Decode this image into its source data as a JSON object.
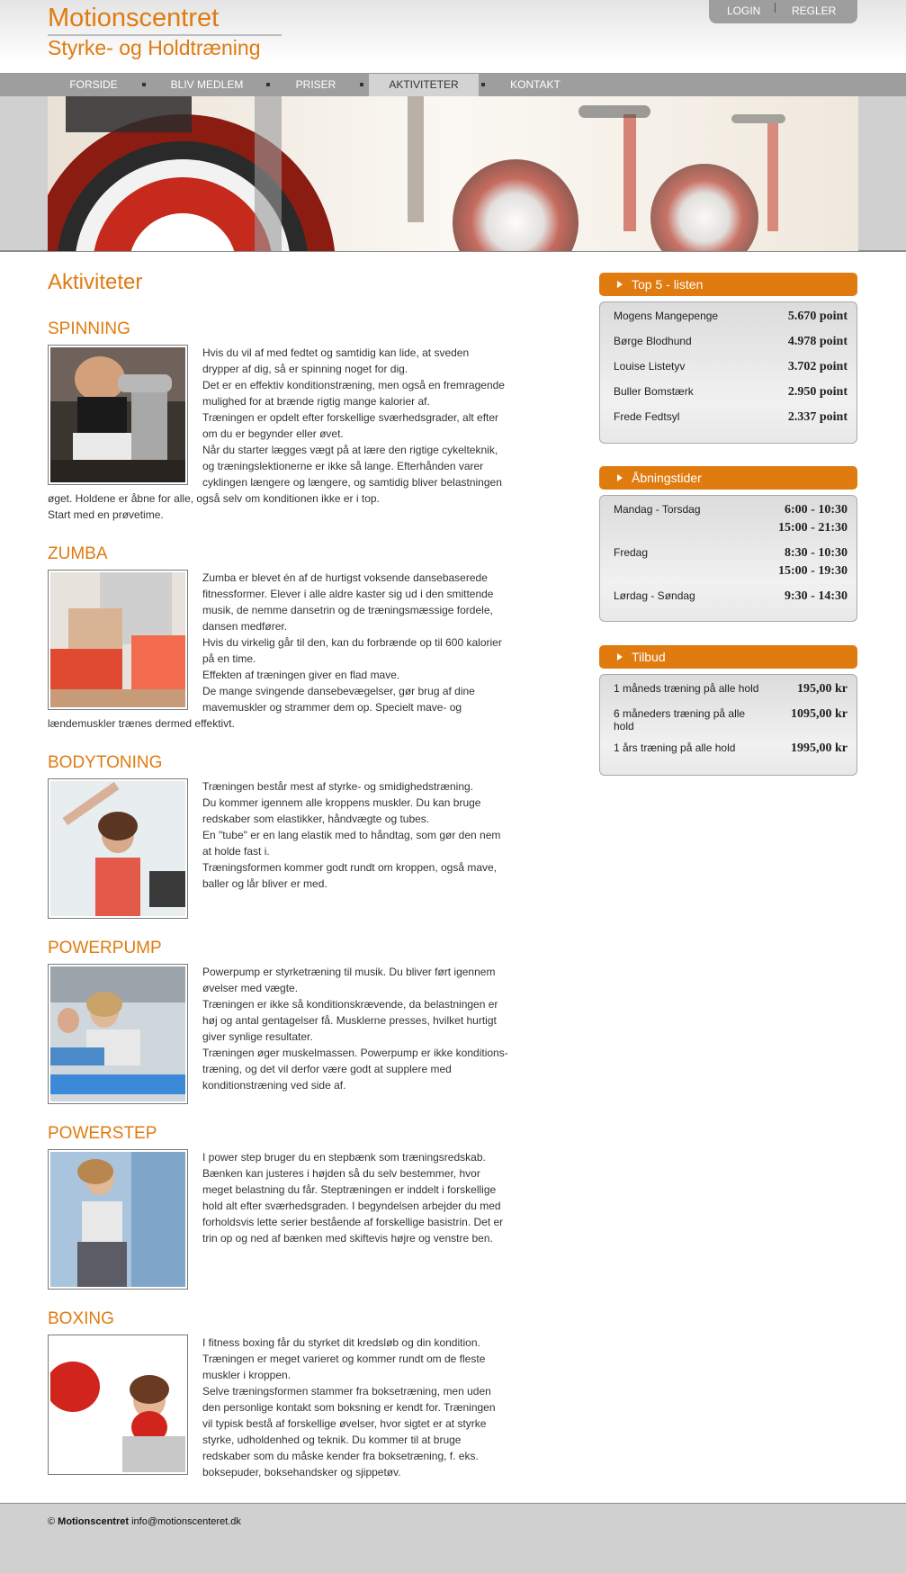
{
  "header": {
    "site_title": "Motionscentret",
    "site_subtitle": "Styrke- og Holdtræning",
    "login_label": "LOGIN",
    "rules_label": "REGLER"
  },
  "nav": {
    "items": [
      {
        "label": "FORSIDE"
      },
      {
        "label": "BLIV MEDLEM"
      },
      {
        "label": "PRISER"
      },
      {
        "label": "AKTIVITETER"
      },
      {
        "label": "KONTAKT"
      }
    ],
    "active": "AKTIVITETER"
  },
  "main": {
    "page_title": "Aktiviteter",
    "activities": [
      {
        "title": "SPINNING",
        "text": "Hvis du vil af med fedtet og samtidig kan lide, at sveden drypper af dig, så er spinning noget for dig.\nDet er en effektiv konditionstræning, men også en fremragende mulighed for at brænde rigtig mange kalorier af.\nTræningen er opdelt efter forskellige sværhedsgrader, alt efter om du er begynder eller øvet.\nNår du starter lægges vægt på at lære den rigtige cykelteknik, og træningslektionerne er ikke så lange. Efterhånden varer cyklingen længere og længere, og samtidig bliver belastningen øget. Holdene er åbne for alle, også selv om konditionen ikke er i top.\nStart med en prøvetime."
      },
      {
        "title": "ZUMBA",
        "text": "Zumba er blevet én af de hurtigst voksende dansebaserede fitnessformer. Elever i alle aldre kaster sig ud i den smittende musik, de nemme dansetrin og de træningsmæssige fordele, dansen medfører.\nHvis du virkelig går til den, kan du forbrænde op til 600 kalorier på en time.\nEffekten af træningen giver en flad mave.\nDe mange svingende dansebevægelser, gør brug af dine mavemuskler og strammer dem op. Specielt mave- og lændemuskler trænes dermed effektivt."
      },
      {
        "title": "BODYTONING",
        "text": "Træningen består mest af styrke- og smidighedstræning.\nDu kommer igennem alle kroppens muskler. Du kan bruge redskaber som elastikker, håndvægte og tubes.\nEn \"tube\" er en lang elastik med to håndtag, som gør den nem at holde fast i.\nTræningsformen kommer godt rundt om kroppen, også mave, baller og lår bliver er med."
      },
      {
        "title": "POWERPUMP",
        "text": "Powerpump er styrketræning til musik. Du bliver ført igennem øvelser med vægte.\nTræningen er ikke så konditionskrævende, da belastningen er høj og antal gentagelser få. Musklerne presses, hvilket hurtigt giver synlige resultater.\nTræningen øger muskelmassen. Powerpump er ikke konditions-træning, og det vil derfor være godt at supplere med konditionstræning ved side af."
      },
      {
        "title": "POWERSTEP",
        "text": "I power step bruger du en stepbænk som træningsredskab. Bænken kan justeres i højden så du selv bestemmer, hvor meget belastning du får. Steptræningen er inddelt i forskellige hold alt efter sværhedsgraden. I begyndelsen arbejder du med forholdsvis lette serier bestående af forskellige basistrin. Det er trin op og ned af bænken med skiftevis højre og venstre ben."
      },
      {
        "title": "BOXING",
        "text": "I fitness boxing får du styrket dit kredsløb og din kondition. Træningen er meget varieret og kommer rundt om de fleste muskler i kroppen.\nSelve træningsformen stammer fra boksetræning, men uden den personlige kontakt som boksning er kendt for. Træningen vil typisk bestå af forskellige øvelser, hvor sigtet er at styrke styrke, udholdenhed og teknik. Du kommer til at bruge redskaber som du måske kender fra boksetræning, f. eks. boksepuder, boksehandsker og sjippetøv."
      }
    ]
  },
  "sidebar": {
    "top5": {
      "title": "Top 5 - listen",
      "rows": [
        {
          "name": "Mogens Mangepenge",
          "value": "5.670 point"
        },
        {
          "name": "Børge Blodhund",
          "value": "4.978 point"
        },
        {
          "name": "Louise Listetyv",
          "value": "3.702 point"
        },
        {
          "name": "Buller Bomstærk",
          "value": "2.950 point"
        },
        {
          "name": "Frede Fedtsyl",
          "value": "2.337 point"
        }
      ]
    },
    "hours": {
      "title": "Åbningstider",
      "rows": [
        {
          "day": "Mandag - Torsdag",
          "time1": "6:00 - 10:30",
          "time2": "15:00 - 21:30"
        },
        {
          "day": "Fredag",
          "time1": "8:30 - 10:30",
          "time2": "15:00 - 19:30"
        },
        {
          "day": "Lørdag - Søndag",
          "time1": "9:30 - 14:30",
          "time2": ""
        }
      ]
    },
    "offers": {
      "title": "Tilbud",
      "rows": [
        {
          "name": "1 måneds træning på alle hold",
          "price": "195,00 kr"
        },
        {
          "name": "6 måneders træning på alle hold",
          "price": "1095,00 kr"
        },
        {
          "name": "1 års træning på alle hold",
          "price": "1995,00 kr"
        }
      ]
    }
  },
  "footer": {
    "copyright": "©",
    "brand": "Motionscentret",
    "email": "info@motionscenteret.dk"
  },
  "colors": {
    "accent": "#e07b10",
    "nav_bg": "#9e9e9e",
    "nav_active": "#d3d3d3"
  }
}
